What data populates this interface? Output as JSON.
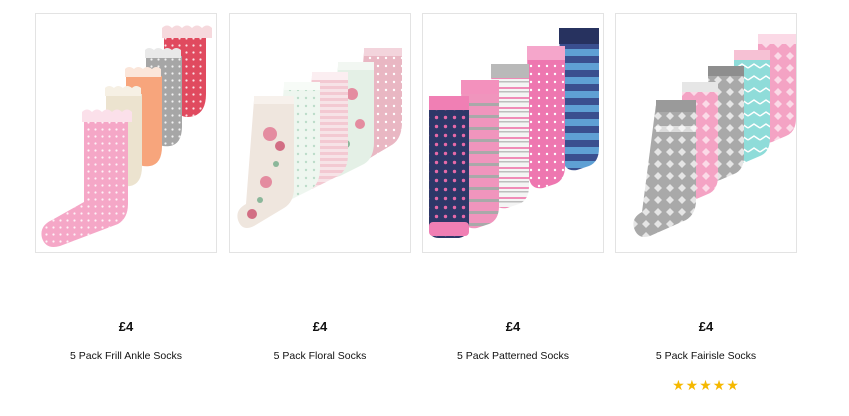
{
  "products": [
    {
      "price": "£4",
      "name": "5 Pack Frill Ankle Socks",
      "image_icon": "socks-frill-image"
    },
    {
      "price": "£4",
      "name": "5 Pack Floral Socks",
      "image_icon": "socks-floral-image"
    },
    {
      "price": "£4",
      "name": "5 Pack Patterned Socks",
      "image_icon": "socks-patterned-image"
    },
    {
      "price": "£4",
      "name": "5 Pack Fairisle Socks",
      "image_icon": "socks-fairisle-image",
      "rating": 5,
      "rating_max": 5
    }
  ],
  "colors": {
    "star": "#f5b800",
    "card_border": "#e3e3e3"
  }
}
